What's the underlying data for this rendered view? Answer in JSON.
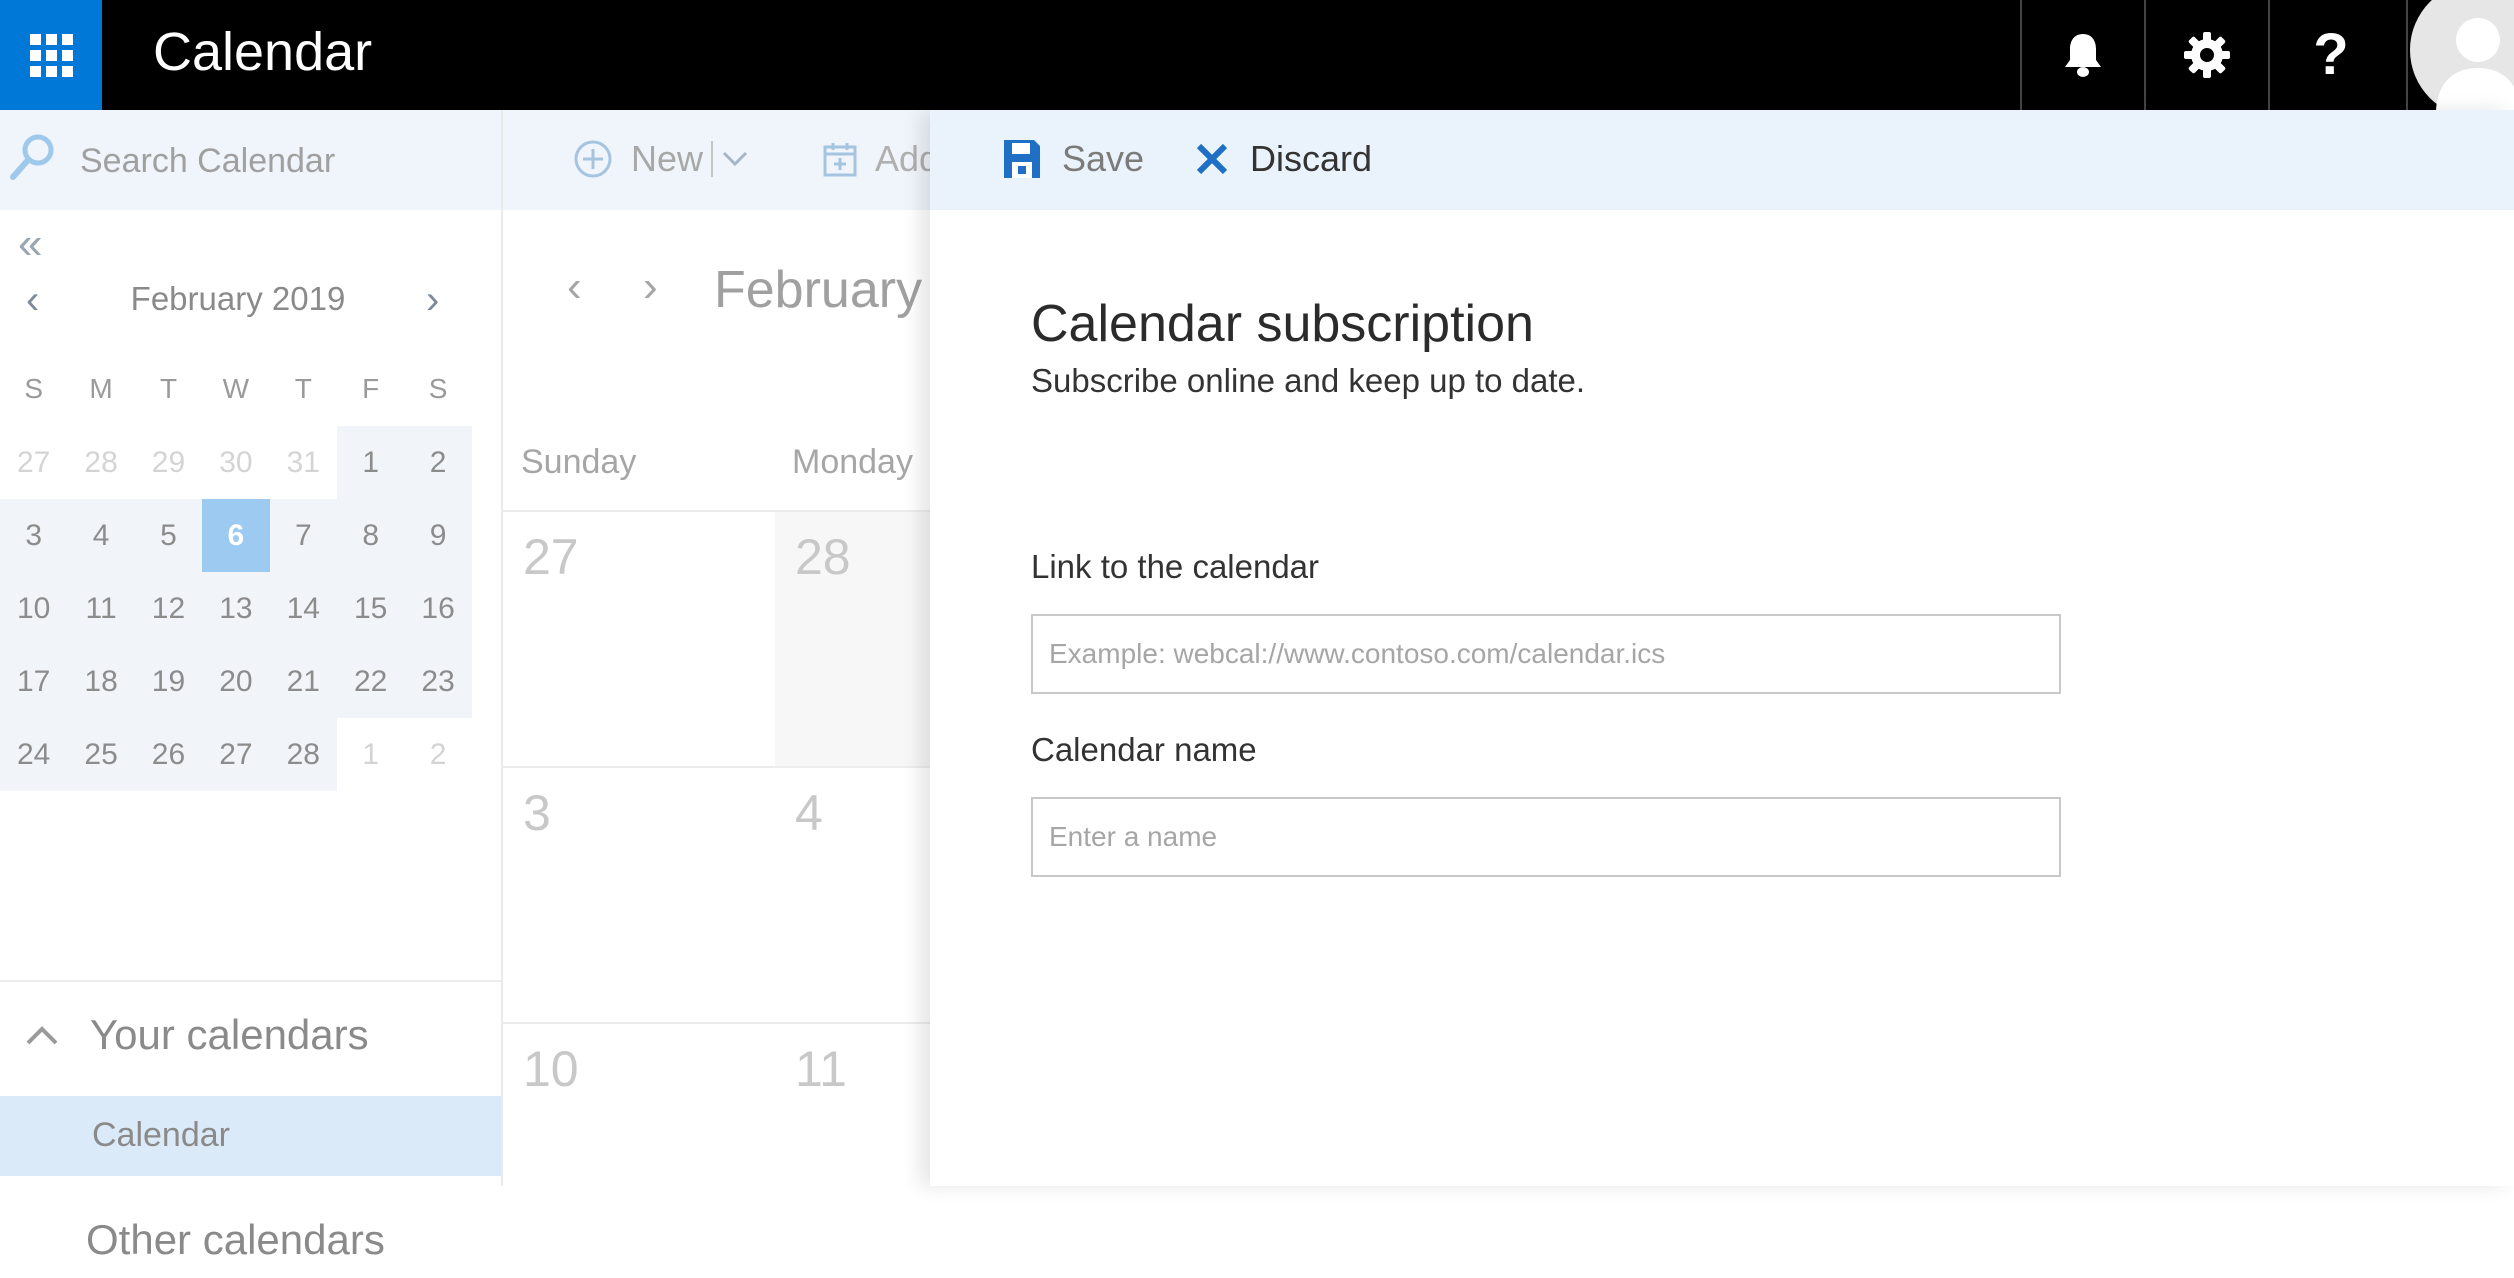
{
  "app": {
    "title": "Calendar"
  },
  "topbar": {
    "icons": [
      "app-launcher-icon",
      "bell-icon",
      "gear-icon",
      "help-icon",
      "avatar-icon"
    ],
    "help_glyph": "?"
  },
  "search": {
    "placeholder": "Search Calendar"
  },
  "mini_calendar": {
    "collapse_glyph": "«",
    "prev_glyph": "‹",
    "next_glyph": "›",
    "month_label": "February 2019",
    "weekdays": [
      "S",
      "M",
      "T",
      "W",
      "T",
      "F",
      "S"
    ],
    "days": [
      [
        "27",
        "28",
        "29",
        "30",
        "31",
        "1",
        "2"
      ],
      [
        "3",
        "4",
        "5",
        "6",
        "7",
        "8",
        "9"
      ],
      [
        "10",
        "11",
        "12",
        "13",
        "14",
        "15",
        "16"
      ],
      [
        "17",
        "18",
        "19",
        "20",
        "21",
        "22",
        "23"
      ],
      [
        "24",
        "25",
        "26",
        "27",
        "28",
        "1",
        "2"
      ]
    ],
    "today": "6"
  },
  "folders": {
    "your_calendars_label": "Your calendars",
    "calendar_item_label": "Calendar",
    "other_calendars_label": "Other calendars"
  },
  "toolbar": {
    "new_label": "New",
    "add_label": "Add calendar"
  },
  "main_calendar": {
    "prev_glyph": "‹",
    "next_glyph": "›",
    "month_label": "February",
    "columns": [
      "Sunday",
      "Monday"
    ],
    "rows": [
      [
        "27",
        "28"
      ],
      [
        "3",
        "4"
      ],
      [
        "10",
        "11"
      ]
    ]
  },
  "panel": {
    "save_label": "Save",
    "discard_label": "Discard",
    "title": "Calendar subscription",
    "subtitle": "Subscribe online and keep up to date.",
    "link_label": "Link to the calendar",
    "link_placeholder": "Example: webcal://www.contoso.com/calendar.ics",
    "name_label": "Calendar name",
    "name_placeholder": "Enter a name"
  },
  "colors": {
    "brand_blue": "#0078d7",
    "topbar": "#000000",
    "command_bar": "#eff5fb",
    "selected_day": "#9dcaf0",
    "selected_folder": "#dbeaf8"
  }
}
